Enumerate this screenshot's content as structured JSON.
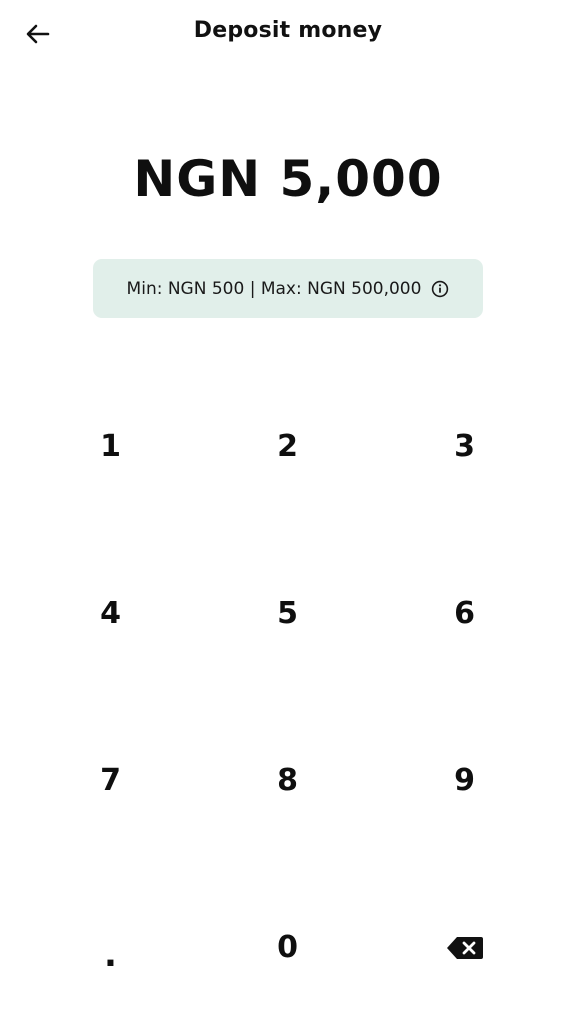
{
  "header": {
    "title": "Deposit money",
    "back_icon": "arrow-left-icon"
  },
  "amount": {
    "display": "NGN 5,000",
    "currency": "NGN",
    "value": "5,000"
  },
  "limits": {
    "text": "Min: NGN 500 | Max: NGN 500,000",
    "info_icon": "info-icon",
    "background_color": "#e1efea"
  },
  "keypad": {
    "keys": [
      "1",
      "2",
      "3",
      "4",
      "5",
      "6",
      "7",
      "8",
      "9",
      ".",
      "0"
    ],
    "backspace_icon": "backspace-icon"
  }
}
